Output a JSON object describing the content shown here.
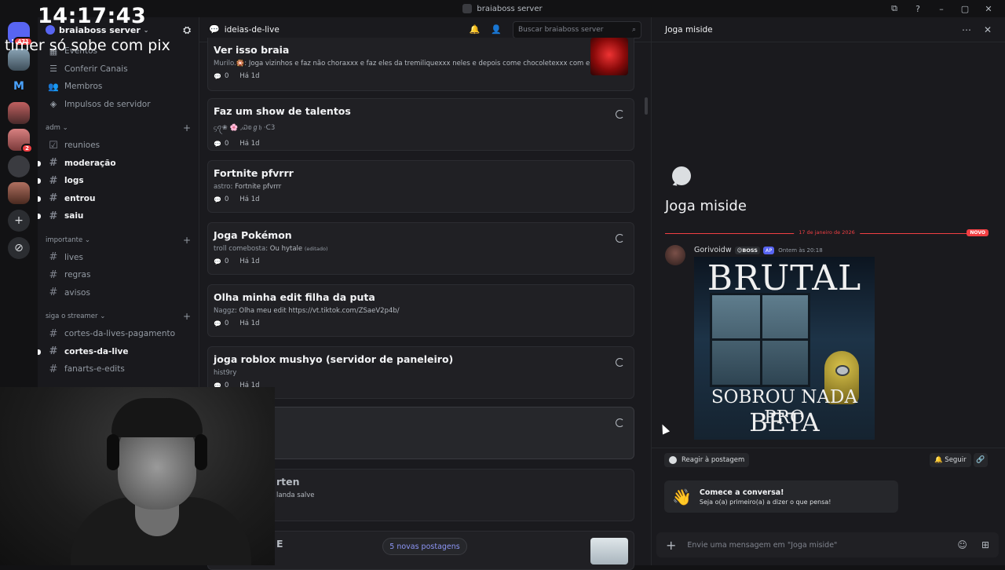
{
  "window": {
    "title": "braiaboss server",
    "controls": [
      "⧉",
      "?",
      "–",
      "▢",
      "✕"
    ]
  },
  "overlay": {
    "time": "14:17:43",
    "message": "timer só sobe com pix"
  },
  "guilds": {
    "home_badge": "471",
    "dm_badge": "2",
    "add_icon": "+",
    "discover_icon": "⊘"
  },
  "sidebar": {
    "server_name": "braiaboss server",
    "nav_items": [
      {
        "icon": "calendar-icon",
        "glyph": "▦",
        "label": "Eventos"
      },
      {
        "icon": "browse-channels-icon",
        "glyph": "☰",
        "label": "Conferir Canais"
      },
      {
        "icon": "members-icon",
        "glyph": "👥",
        "label": "Membros"
      },
      {
        "icon": "boost-icon",
        "glyph": "◈",
        "label": "Impulsos de servidor"
      }
    ],
    "categories": [
      {
        "name": "adm",
        "channels": [
          {
            "name": "reunioes",
            "unread": false,
            "icon": "checkbox-icon"
          },
          {
            "name": "moderação",
            "unread": true
          },
          {
            "name": "logs",
            "unread": true
          },
          {
            "name": "entrou",
            "unread": true
          },
          {
            "name": "saiu",
            "unread": true
          }
        ]
      },
      {
        "name": "importante",
        "channels": [
          {
            "name": "lives",
            "unread": false
          },
          {
            "name": "regras",
            "unread": false
          },
          {
            "name": "avisos",
            "unread": false
          }
        ]
      },
      {
        "name": "siga o streamer",
        "channels": [
          {
            "name": "cortes-da-lives-pagamento",
            "unread": false
          },
          {
            "name": "cortes-da-live",
            "unread": true
          },
          {
            "name": "fanarts-e-edits",
            "unread": false
          }
        ]
      }
    ]
  },
  "main": {
    "channel_name": "ideias-de-live",
    "search_placeholder": "Buscar braiaboss server",
    "new_posts_label": "5 novas postagens",
    "posts": [
      {
        "title": "Ver isso braia",
        "author": "Murilo.🎇",
        "preview": "Joga vizinhos e faz não choraxxx e faz eles da tremiliquexxx neles e depois come chocoletexxx com eles",
        "replies": "0",
        "age": "Há 1d",
        "thumb": "red-heart-thumbnail"
      },
      {
        "title": "Faz um show de talentos",
        "author": "ᦓꪖ❀ 🌸 ,Ꮗ𝕠ℊ𝔥 ·ᑕ3",
        "preview": "",
        "replies": "0",
        "age": "Há 1d",
        "spinner": true
      },
      {
        "title": "Fortnite pfvrrr",
        "author": "astro",
        "preview": "Fortnite pfvrrr",
        "replies": "0",
        "age": "Há 1d"
      },
      {
        "title": "Joga Pokémon",
        "author": "troll comebosta",
        "preview": "Ou hytale",
        "edited": "(editado)",
        "replies": "0",
        "age": "Há 1d",
        "spinner": true
      },
      {
        "title": "Olha minha edit filha da puta",
        "author": "Naggz",
        "preview": "Olha meu edit https://vt.tiktok.com/ZSaeV2p4b/",
        "replies": "0",
        "age": "Há 1d"
      },
      {
        "title": "joga roblox mushyo (servidor de paneleiro)",
        "author": "hist9ry",
        "preview": "",
        "replies": "0",
        "age": "Há 1d",
        "spinner": true
      },
      {
        "title": "",
        "author": "",
        "preview": "",
        "replies": "",
        "age": "",
        "spinner": true
      },
      {
        "title": "rten",
        "author": "",
        "preview": "landa salve",
        "replies": "",
        "age": ""
      },
      {
        "title": "E",
        "author": "",
        "preview": "",
        "replies": "",
        "age": "",
        "thumb": "gray-thumbnail"
      }
    ]
  },
  "thread": {
    "title": "Joga miside",
    "post_title": "Joga miside",
    "date_divider": "17 de janeiro de 2026",
    "new_label": "NOVO",
    "message": {
      "author": "Gorivoidw",
      "tag": "😉BOSS",
      "app_tag": "AP",
      "time": "Ontem às 20:18",
      "meme_top": "BRUTAL",
      "meme_bottom_line1": "SOBROU NADA PRO",
      "meme_bottom_line2": "BETA"
    },
    "react_label": "Reagir à postagem",
    "follow_label": "Seguir",
    "starter_title": "Comece a conversa!",
    "starter_subtitle": "Seja o(a) primeiro(a) a dizer o que pensa!",
    "composer_placeholder": "Envie uma mensagem em \"Joga miside\""
  }
}
